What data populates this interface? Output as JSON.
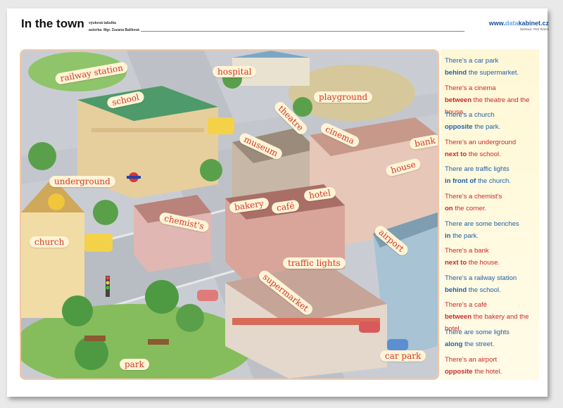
{
  "header": {
    "title": "In the town",
    "subtitle1": "výuková tabulka",
    "subtitle2": "autorka: Mgr. Zuzana Balíková",
    "brand_prefix": "www.",
    "brand_mid": "data",
    "brand_suffix": "kabinet.cz",
    "brand_author": "ilustrace: Petr Šimek"
  },
  "map_labels": {
    "railway_station": "railway station",
    "hospital": "hospital",
    "school": "school",
    "playground": "playground",
    "theatre": "theatre",
    "cinema": "cinema",
    "bank": "bank",
    "museum": "museum",
    "house": "house",
    "underground": "underground",
    "hotel": "hotel",
    "bakery": "bakery",
    "cafe": "café",
    "chemists": "chemist's",
    "church": "church",
    "airport": "airport",
    "traffic_lights": "traffic lights",
    "supermarket": "supermarket",
    "park": "park",
    "car_park": "car park"
  },
  "sentences": [
    {
      "pre": "There's a car park",
      "key": "behind",
      "post": "the supermarket.",
      "color": "blue"
    },
    {
      "pre": "There's a cinema",
      "key": "between",
      "post": "the theatre and the house.",
      "color": "red"
    },
    {
      "pre": "There's a church",
      "key": "opposite",
      "post": "the park.",
      "color": "blue"
    },
    {
      "pre": "There's an underground",
      "key": "next to",
      "post": "the school.",
      "color": "red"
    },
    {
      "pre": "There are traffic lights",
      "key": "in front of",
      "post": "the church.",
      "color": "blue"
    },
    {
      "pre": "There's a chemist's",
      "key": "on",
      "post": "the corner.",
      "color": "red"
    },
    {
      "pre": "There are some benches",
      "key": "in",
      "post": "the park.",
      "color": "blue"
    },
    {
      "pre": "There's a bank",
      "key": "next to",
      "post": "the house.",
      "color": "red"
    },
    {
      "pre": "There's a railway station",
      "key": "behind",
      "post": "the school.",
      "color": "blue"
    },
    {
      "pre": "There's a café",
      "key": "between",
      "post": "the bakery and the hotel.",
      "color": "red"
    },
    {
      "pre": "There are some lights",
      "key": "along",
      "post": "the street.",
      "color": "blue"
    },
    {
      "pre": "There's an airport",
      "key": "opposite",
      "post": "the hotel.",
      "color": "red"
    }
  ],
  "colors": {
    "blue": "#1f5fa8",
    "red": "#c8282a",
    "label_text": "#d23a2c"
  }
}
